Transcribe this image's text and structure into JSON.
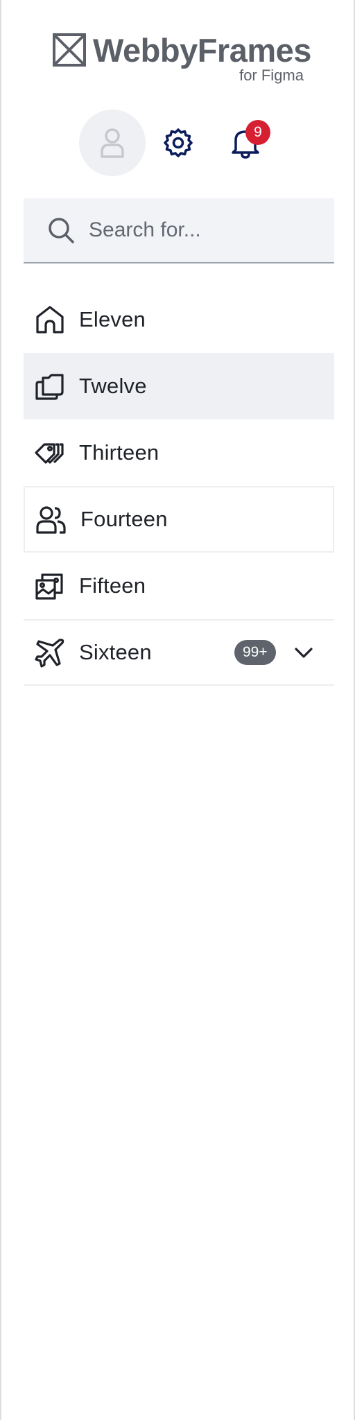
{
  "brand": {
    "name": "WebbyFrames",
    "subtitle": "for Figma",
    "logo_icon": "x-box-icon",
    "color": "#5b5f67"
  },
  "header": {
    "avatar_icon": "user-icon",
    "settings_icon": "gear-icon",
    "notifications_icon": "bell-icon",
    "notification_count": "9",
    "badge_color": "#d71f32",
    "icon_color": "#0b1c5c"
  },
  "search": {
    "placeholder": "Search for...",
    "value": "",
    "icon": "search-icon"
  },
  "nav": {
    "items": [
      {
        "label": "Eleven",
        "icon": "home-icon",
        "state": "default"
      },
      {
        "label": "Twelve",
        "icon": "folders-icon",
        "state": "selected"
      },
      {
        "label": "Thirteen",
        "icon": "tags-icon",
        "state": "default"
      },
      {
        "label": "Fourteen",
        "icon": "users-icon",
        "state": "hover"
      },
      {
        "label": "Fifteen",
        "icon": "images-icon",
        "state": "default"
      },
      {
        "label": "Sixteen",
        "icon": "plane-icon",
        "state": "collapsed",
        "badge": "99+",
        "expand_icon": "chevron-down-icon"
      }
    ]
  }
}
